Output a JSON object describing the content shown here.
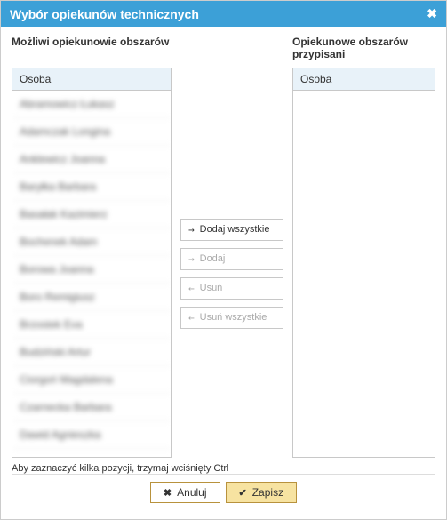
{
  "dialog": {
    "title": "Wybór opiekunów technicznych"
  },
  "left": {
    "title": "Możliwi opiekunowie obszarów",
    "column_header": "Osoba",
    "items": [
      "Abramowicz Łukasz",
      "Adamczak Longina",
      "Anklewicz Joanna",
      "Baryłka Barbara",
      "Basałak Kazimierz",
      "Bochenek Adam",
      "Borowa Joanna",
      "Boro Remigiusz",
      "Brzostek Eva",
      "Budziński Artur",
      "Ciorgoń Magdalena",
      "Czarnecka Barbara",
      "Dawid Agnieszka"
    ]
  },
  "right": {
    "title": "Opiekunowe obszarów przypisani",
    "column_header": "Osoba",
    "items": []
  },
  "buttons": {
    "add_all": "Dodaj wszystkie",
    "add": "Dodaj",
    "remove": "Usuń",
    "remove_all": "Usuń wszystkie"
  },
  "hint": "Aby zaznaczyć kilka pozycji, trzymaj wciśnięty Ctrl",
  "footer": {
    "cancel": "Anuluj",
    "save": "Zapisz"
  }
}
